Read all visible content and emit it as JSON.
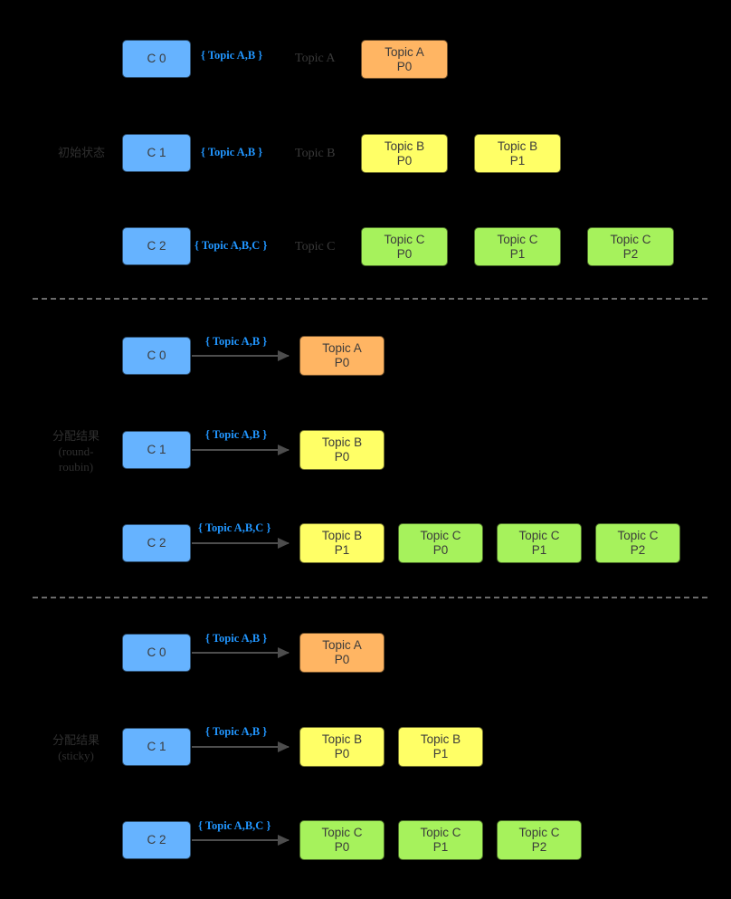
{
  "diagram": {
    "title": "Kafka consumer partition assignment strategies",
    "colors": {
      "background": "#000000",
      "consumer": "#66b3ff",
      "topic_a": "#ffb563",
      "topic_b": "#ffff66",
      "topic_c": "#a6f25c",
      "subscription_text": "#2196ff",
      "label_text": "#3a3a3a",
      "arrow": "#4d4d4d",
      "divider": "#6a6a6a"
    }
  },
  "sections": [
    {
      "id": "initial-state",
      "side_label": "初始状态",
      "rows": [
        {
          "consumer": "C 0",
          "subscription": "{ Topic A,B }",
          "topic_label": "Topic A",
          "partitions": [
            {
              "line1": "Topic A",
              "line2": "P0",
              "color": "topic-a"
            }
          ]
        },
        {
          "consumer": "C 1",
          "subscription": "{ Topic A,B }",
          "topic_label": "Topic B",
          "partitions": [
            {
              "line1": "Topic B",
              "line2": "P0",
              "color": "topic-b"
            },
            {
              "line1": "Topic B",
              "line2": "P1",
              "color": "topic-b"
            }
          ]
        },
        {
          "consumer": "C 2",
          "subscription": "{ Topic A,B,C }",
          "topic_label": "Topic C",
          "partitions": [
            {
              "line1": "Topic C",
              "line2": "P0",
              "color": "topic-c"
            },
            {
              "line1": "Topic C",
              "line2": "P1",
              "color": "topic-c"
            },
            {
              "line1": "Topic C",
              "line2": "P2",
              "color": "topic-c"
            }
          ]
        }
      ]
    },
    {
      "id": "round-robin-result",
      "side_label": "分配结果\n(round-\nroubin)",
      "rows": [
        {
          "consumer": "C 0",
          "subscription": "{ Topic A,B }",
          "partitions": [
            {
              "line1": "Topic A",
              "line2": "P0",
              "color": "topic-a"
            }
          ]
        },
        {
          "consumer": "C 1",
          "subscription": "{ Topic A,B }",
          "partitions": [
            {
              "line1": "Topic B",
              "line2": "P0",
              "color": "topic-b"
            }
          ]
        },
        {
          "consumer": "C 2",
          "subscription": "{ Topic A,B,C }",
          "partitions": [
            {
              "line1": "Topic B",
              "line2": "P1",
              "color": "topic-b"
            },
            {
              "line1": "Topic C",
              "line2": "P0",
              "color": "topic-c"
            },
            {
              "line1": "Topic C",
              "line2": "P1",
              "color": "topic-c"
            },
            {
              "line1": "Topic C",
              "line2": "P2",
              "color": "topic-c"
            }
          ]
        }
      ]
    },
    {
      "id": "sticky-result",
      "side_label": "分配结果\n(sticky)",
      "rows": [
        {
          "consumer": "C 0",
          "subscription": "{ Topic A,B }",
          "partitions": [
            {
              "line1": "Topic A",
              "line2": "P0",
              "color": "topic-a"
            }
          ]
        },
        {
          "consumer": "C 1",
          "subscription": "{ Topic A,B }",
          "partitions": [
            {
              "line1": "Topic B",
              "line2": "P0",
              "color": "topic-b"
            },
            {
              "line1": "Topic B",
              "line2": "P1",
              "color": "topic-b"
            }
          ]
        },
        {
          "consumer": "C 2",
          "subscription": "{ Topic A,B,C }",
          "partitions": [
            {
              "line1": "Topic C",
              "line2": "P0",
              "color": "topic-c"
            },
            {
              "line1": "Topic C",
              "line2": "P1",
              "color": "topic-c"
            },
            {
              "line1": "Topic C",
              "line2": "P2",
              "color": "topic-c"
            }
          ]
        }
      ]
    }
  ]
}
